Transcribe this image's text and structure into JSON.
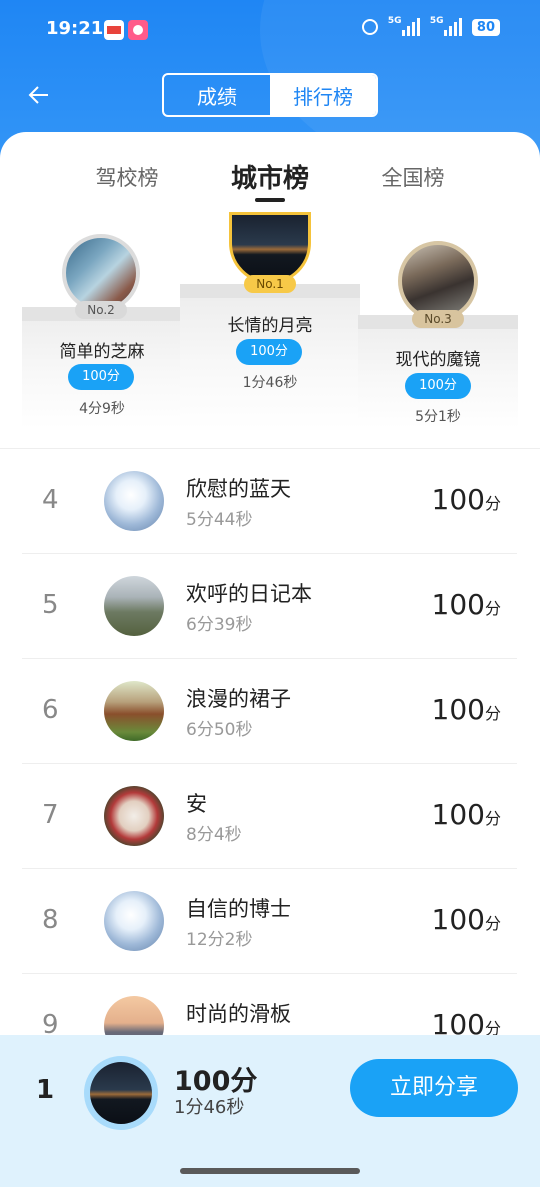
{
  "status_bar": {
    "time": "19:21",
    "network1": "5G",
    "network2": "5G",
    "battery": "80"
  },
  "header": {
    "back_icon": "arrow-left-icon",
    "segments": [
      {
        "label": "成绩",
        "active": false
      },
      {
        "label": "排行榜",
        "active": true
      }
    ]
  },
  "tabs": [
    {
      "label": "驾校榜",
      "active": false
    },
    {
      "label": "城市榜",
      "active": true
    },
    {
      "label": "全国榜",
      "active": false
    }
  ],
  "podium": {
    "first": {
      "badge": "No.1",
      "name": "长情的月亮",
      "score": "100分",
      "time": "1分46秒"
    },
    "second": {
      "badge": "No.2",
      "name": "简单的芝麻",
      "score": "100分",
      "time": "4分9秒"
    },
    "third": {
      "badge": "No.3",
      "name": "现代的魔镜",
      "score": "100分",
      "time": "5分1秒"
    }
  },
  "rankings": [
    {
      "rank": "4",
      "name": "欣慰的蓝天",
      "time": "5分44秒",
      "score": "100",
      "unit": "分"
    },
    {
      "rank": "5",
      "name": "欢呼的日记本",
      "time": "6分39秒",
      "score": "100",
      "unit": "分"
    },
    {
      "rank": "6",
      "name": "浪漫的裙子",
      "time": "6分50秒",
      "score": "100",
      "unit": "分"
    },
    {
      "rank": "7",
      "name": "安",
      "time": "8分4秒",
      "score": "100",
      "unit": "分"
    },
    {
      "rank": "8",
      "name": "自信的博士",
      "time": "12分2秒",
      "score": "100",
      "unit": "分"
    },
    {
      "rank": "9",
      "name": "时尚的滑板",
      "time": "",
      "score": "100",
      "unit": "分"
    }
  ],
  "my_rank": {
    "rank": "1",
    "score": "100分",
    "time": "1分46秒",
    "share_label": "立即分享"
  },
  "colors": {
    "header_blue": "#1f86f4",
    "accent_blue": "#1aa2f6",
    "bottom_bar": "#dff2fd"
  }
}
